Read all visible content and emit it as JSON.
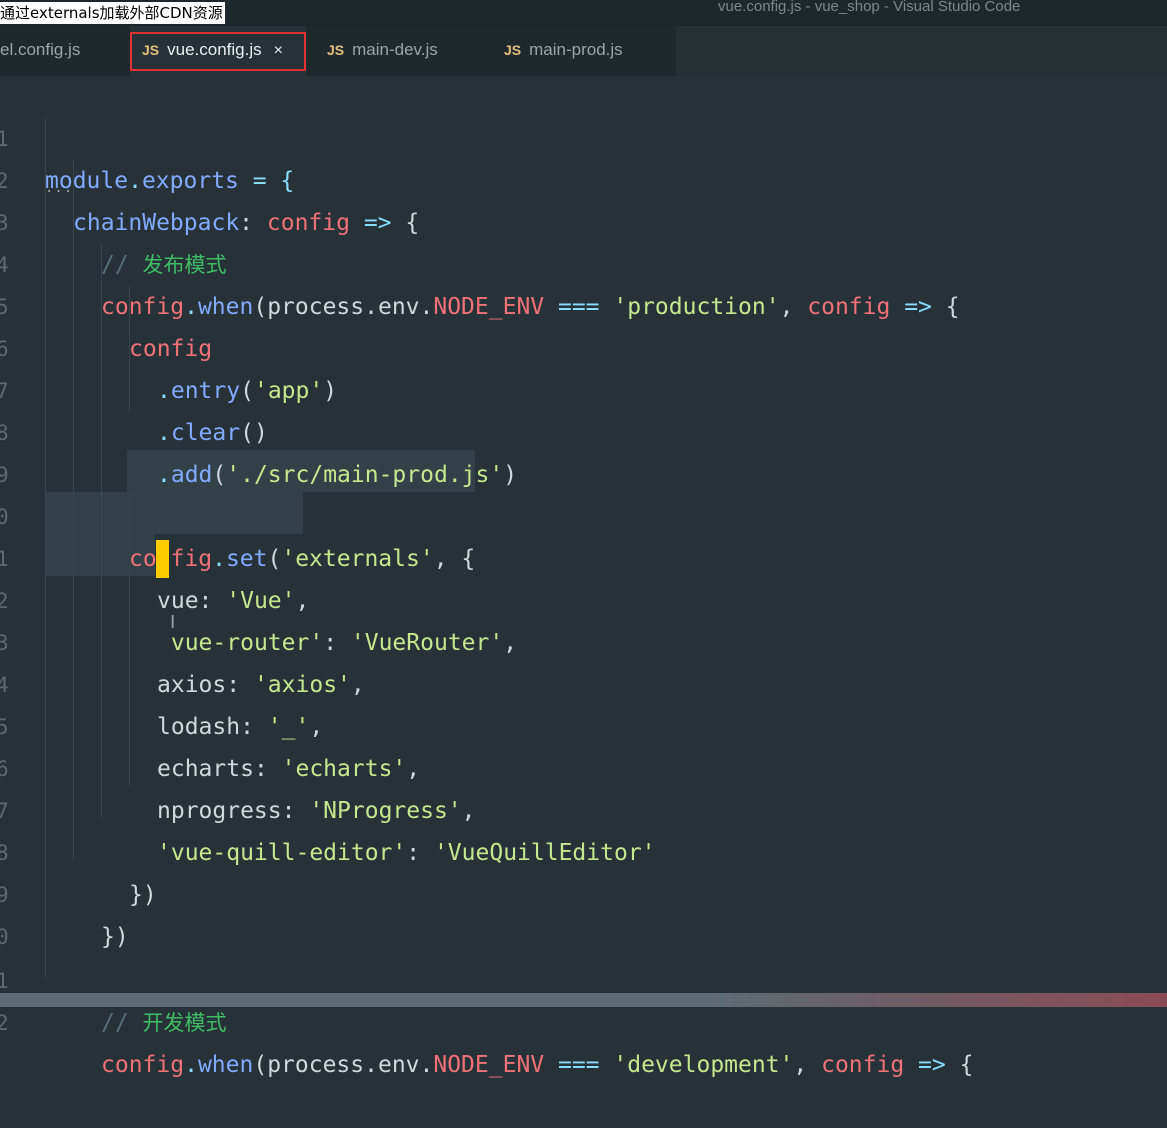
{
  "titlebar": {
    "caption": "通过externals加载外部CDN资源",
    "window_title": "vue.config.js - vue_shop - Visual Studio Code"
  },
  "tabs": [
    {
      "icon": "",
      "label": "el.config.js",
      "active": false
    },
    {
      "icon": "JS",
      "label": "vue.config.js",
      "active": true,
      "close": "×"
    },
    {
      "icon": "JS",
      "label": "main-dev.js",
      "active": false
    },
    {
      "icon": "JS",
      "label": "main-prod.js",
      "active": false
    }
  ],
  "editor": {
    "line_numbers": [
      "1",
      "2",
      "3",
      "4",
      "5",
      "6",
      "7",
      "8",
      "9",
      "0",
      "1",
      "2",
      "3",
      "4",
      "5",
      "6",
      "7",
      "8",
      "9",
      "0",
      "1",
      "2"
    ],
    "lines": {
      "l1": {
        "a": "module",
        "b": ".",
        "c": "exports",
        "d": " = {"
      },
      "l2": {
        "a": "chainWebpack",
        "b": ": ",
        "c": "config",
        "d": " => ",
        "e": "{"
      },
      "l3": {
        "a": "// ",
        "b": "发布模式"
      },
      "l4": {
        "a": "config",
        "b": ".",
        "c": "when",
        "d": "(process.env.",
        "e": "NODE_ENV",
        "f": " === ",
        "g": "'production'",
        "h": ", ",
        "i": "config",
        "j": " => ",
        "k": "{"
      },
      "l5": {
        "a": "config"
      },
      "l6": {
        "a": ".",
        "b": "entry",
        "c": "(",
        "d": "'app'",
        "e": ")"
      },
      "l7": {
        "a": ".",
        "b": "clear",
        "c": "()"
      },
      "l8": {
        "a": ".",
        "b": "add",
        "c": "(",
        "d": "'./src/main-prod.js'",
        "e": ")"
      },
      "l10": {
        "a": "config",
        "b": ".",
        "c": "set",
        "d": "(",
        "e": "'externals'",
        "f": ", {"
      },
      "l11": {
        "a": "vue",
        "b": ": ",
        "c": "'Vue'",
        "d": ","
      },
      "l12": {
        "a": "'",
        "b": "vue-router'",
        "c": ": ",
        "d": "'VueRouter'",
        "e": ","
      },
      "l13": {
        "a": "axios",
        "b": ": ",
        "c": "'axios'",
        "d": ","
      },
      "l14": {
        "a": "lodash",
        "b": ": ",
        "c": "'_'",
        "d": ","
      },
      "l15": {
        "a": "echarts",
        "b": ": ",
        "c": "'echarts'",
        "d": ","
      },
      "l16": {
        "a": "nprogress",
        "b": ": ",
        "c": "'NProgress'",
        "d": ","
      },
      "l17": {
        "a": "'vue-quill-editor'",
        "b": ": ",
        "c": "'VueQuillEditor'"
      },
      "l18": {
        "a": "})"
      },
      "l19": {
        "a": "})"
      },
      "l21": {
        "a": "// ",
        "b": "开发模式"
      },
      "l22": {
        "a": "config",
        "b": ".",
        "c": "when",
        "d": "(process.env.",
        "e": "NODE_ENV",
        "f": " === ",
        "g": "'development'",
        "h": ", ",
        "i": "config",
        "j": " => ",
        "k": "{"
      }
    },
    "fold_dots": "...",
    "cursor_icon": "text-cursor-icon"
  },
  "colors": {
    "background": "#263238",
    "keyword_blue": "#82aaff",
    "variable_red": "#f07178",
    "string_green": "#c3e88d",
    "operator_cyan": "#89ddff",
    "comment_green": "#3fbd65",
    "active_tab_border": "#e03232",
    "cursor": "#ffcc00"
  }
}
